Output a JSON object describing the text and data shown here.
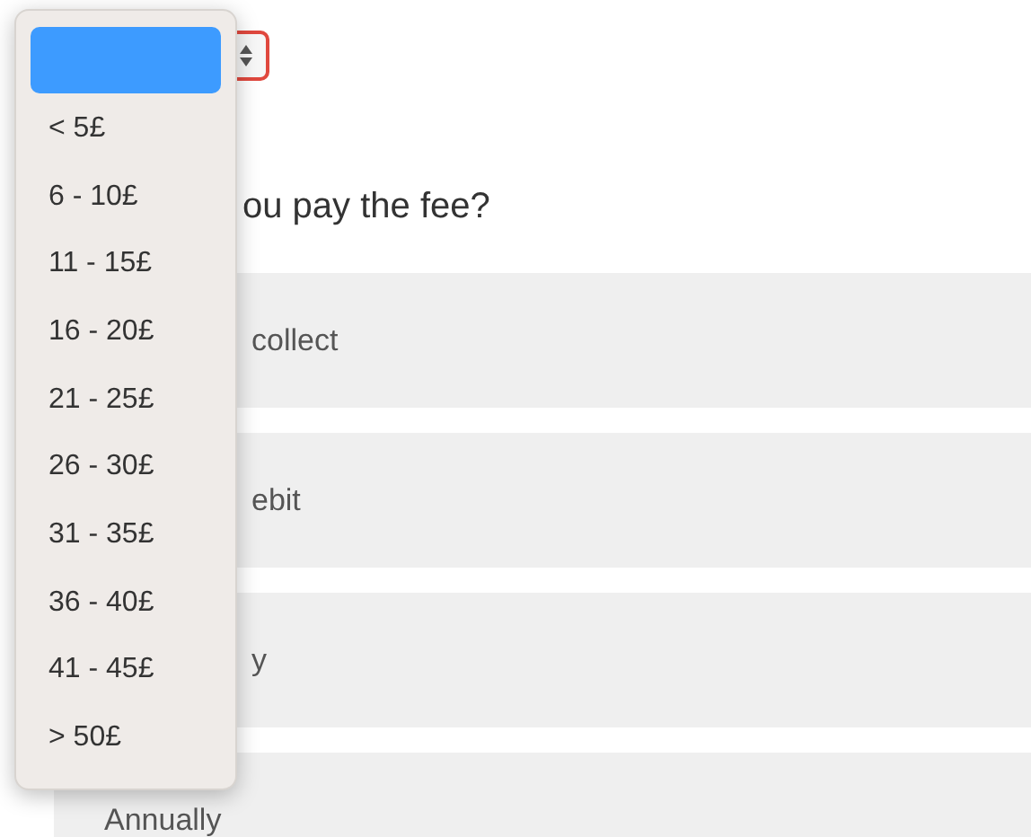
{
  "select": {
    "invalid": true
  },
  "menu": {
    "blank_option_selected": true,
    "options": [
      {
        "label": "< 5£",
        "selected": false
      },
      {
        "label": "6 - 10£",
        "selected": false
      },
      {
        "label": "11 - 15£",
        "selected": false
      },
      {
        "label": "16 - 20£",
        "selected": false
      },
      {
        "label": "21 - 25£",
        "selected": false
      },
      {
        "label": "26 - 30£",
        "selected": false
      },
      {
        "label": "31 - 35£",
        "selected": false
      },
      {
        "label": "36 - 40£",
        "selected": false
      },
      {
        "label": "41 - 45£",
        "selected": false
      },
      {
        "label": "> 50£",
        "selected": false
      }
    ]
  },
  "question": "ou pay the fee?",
  "answers": [
    {
      "label": "collect"
    },
    {
      "label": "ebit"
    },
    {
      "label": "y"
    },
    {
      "label": "Annually"
    }
  ]
}
